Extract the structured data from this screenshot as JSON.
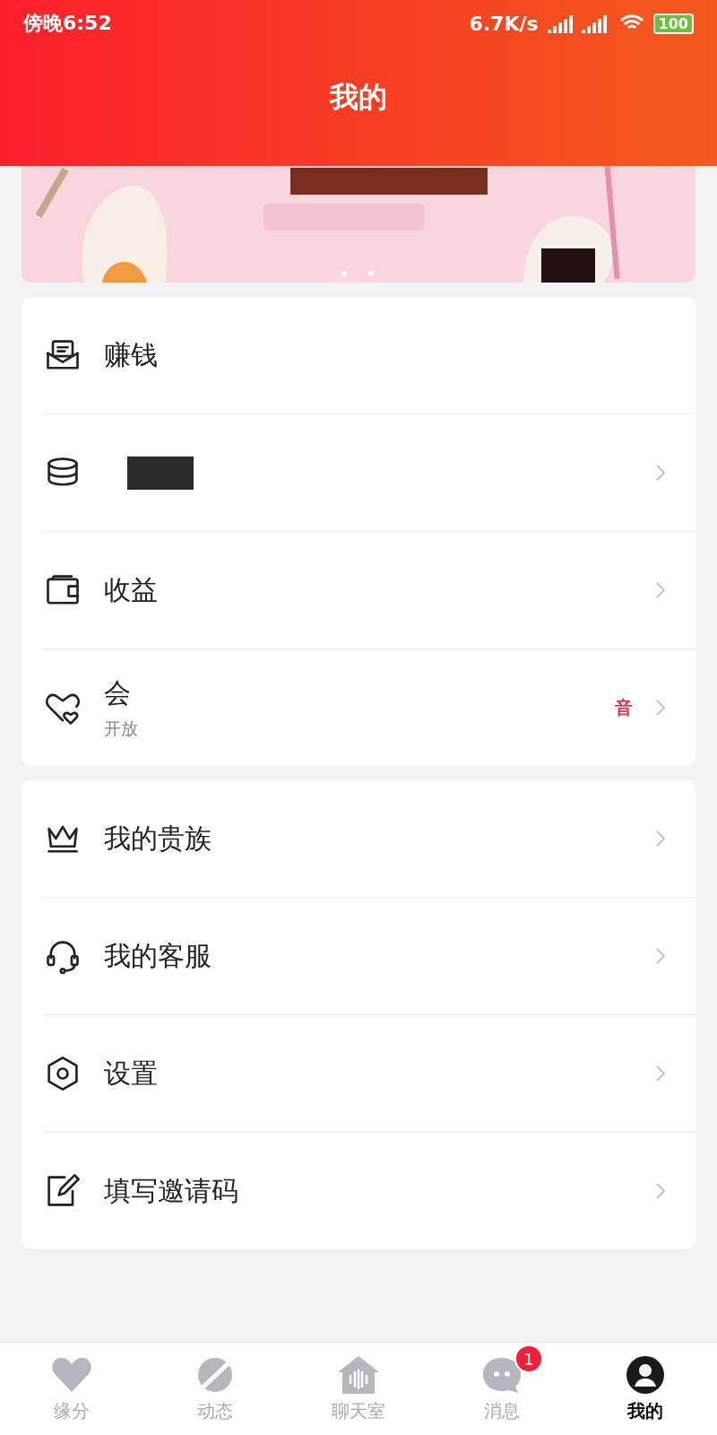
{
  "status_bar": {
    "time": "傍晚6:52",
    "speed": "6.7K/s",
    "battery": "100"
  },
  "header": {
    "title": "我的"
  },
  "groups": [
    {
      "items": [
        {
          "title": "赚钱"
        },
        {
          "redacted": true
        },
        {
          "title": "收益"
        },
        {
          "title": "会",
          "subtitle": "开放",
          "trailing": "音"
        }
      ]
    },
    {
      "items": [
        {
          "title": "我的贵族"
        },
        {
          "title": "我的客服"
        },
        {
          "title": "设置"
        },
        {
          "title": "填写邀请码"
        }
      ]
    }
  ],
  "tabs": [
    {
      "label": "缘分",
      "selected": false
    },
    {
      "label": "动态",
      "selected": false
    },
    {
      "label": "聊天室",
      "selected": false
    },
    {
      "label": "消息",
      "selected": false,
      "badge": "1"
    },
    {
      "label": "我的",
      "selected": true
    }
  ]
}
